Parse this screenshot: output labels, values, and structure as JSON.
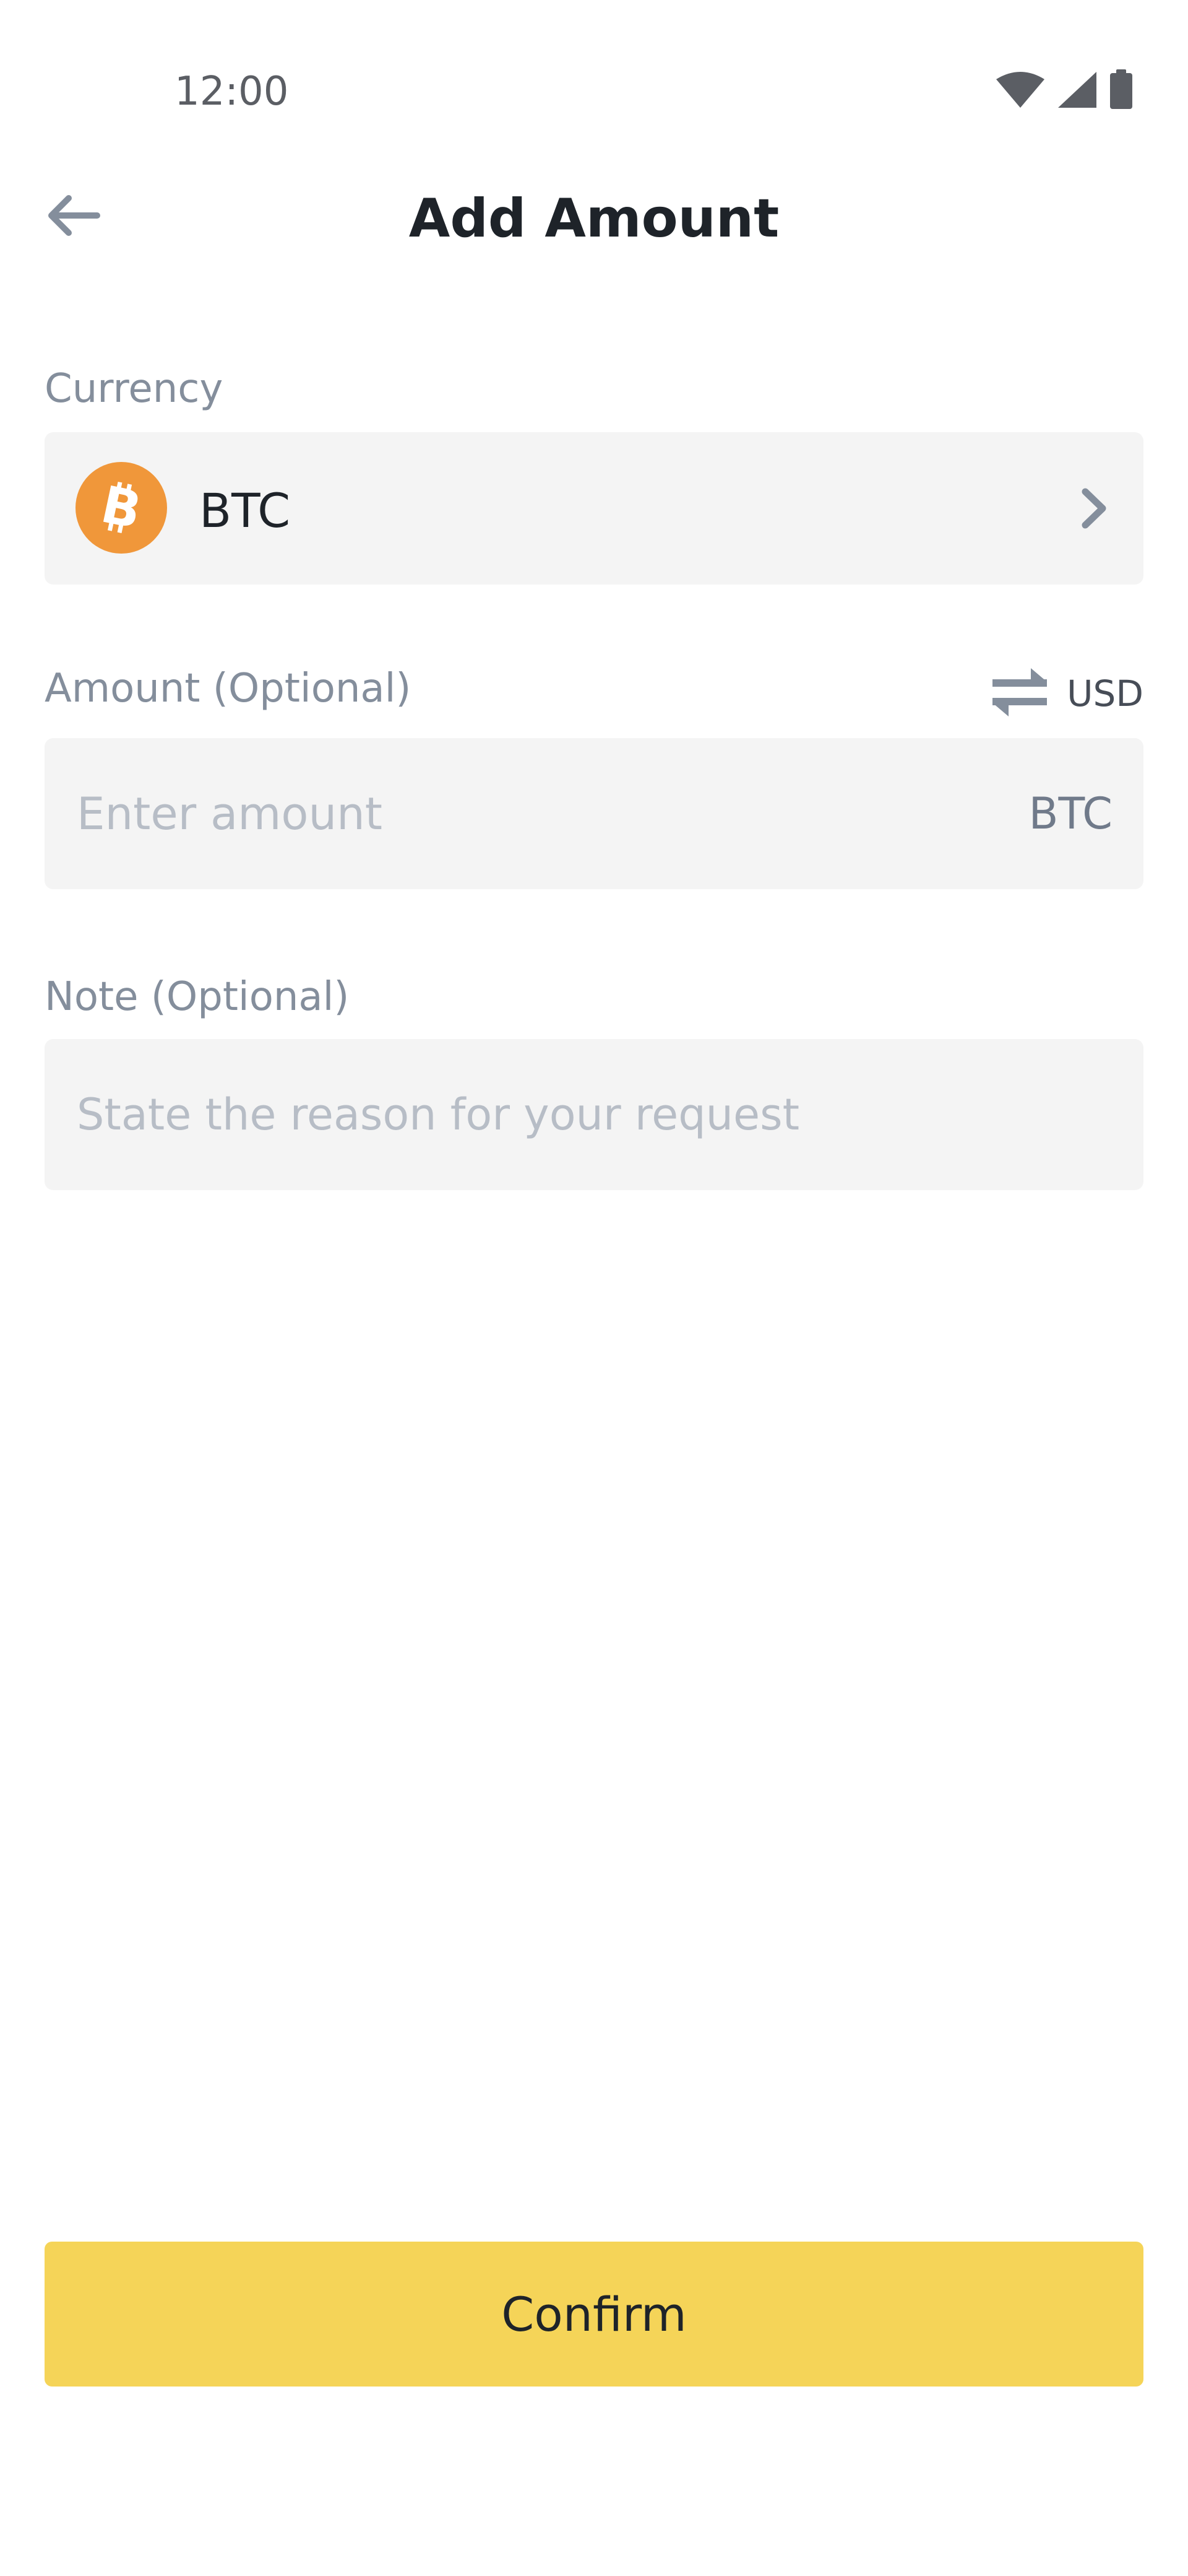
{
  "status_bar": {
    "time": "12:00",
    "icons": [
      "wifi-icon",
      "cell-signal-icon",
      "battery-icon"
    ]
  },
  "header": {
    "title": "Add Amount",
    "back_icon": "arrow-left-icon"
  },
  "currency": {
    "label": "Currency",
    "selected": "BTC",
    "logo_icon": "bitcoin-icon",
    "chevron_icon": "chevron-right-icon"
  },
  "amount": {
    "label": "Amount (Optional)",
    "placeholder": "Enter amount",
    "value": "",
    "unit": "BTC",
    "switch_icon": "swap-arrows-icon",
    "switch_unit": "USD"
  },
  "note": {
    "label": "Note (Optional)",
    "placeholder": "State the reason for your request",
    "value": ""
  },
  "confirm": {
    "label": "Confirm"
  },
  "colors": {
    "accent": "#F5D458",
    "bitcoin": "#F0973A",
    "label": "#848E9C",
    "field_bg": "#F4F4F4",
    "text": "#1E2329"
  }
}
